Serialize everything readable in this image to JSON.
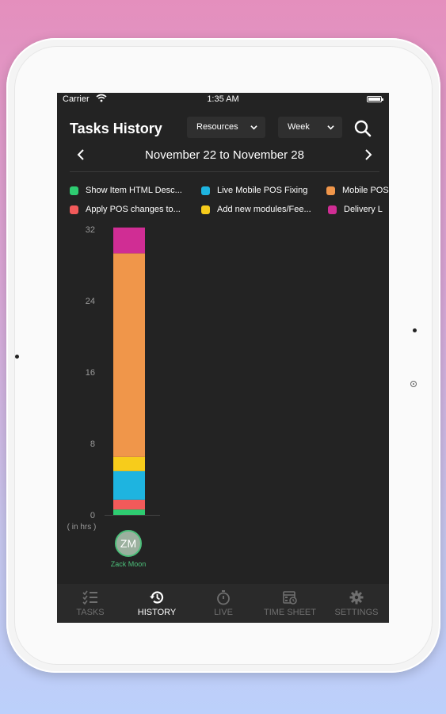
{
  "status_bar": {
    "carrier": "Carrier",
    "time": "1:35 AM"
  },
  "header": {
    "title": "Tasks History",
    "resources_dropdown": "Resources",
    "period_dropdown": "Week"
  },
  "date_nav": {
    "range": "November 22 to November 28"
  },
  "legend": [
    {
      "label": "Show Item HTML Desc...",
      "color": "#2ecc71"
    },
    {
      "label": "Live Mobile POS Fixing",
      "color": "#1eb4e0"
    },
    {
      "label": "Mobile POS",
      "color": "#f0964a"
    },
    {
      "label": "Apply POS changes to...",
      "color": "#f25a5a"
    },
    {
      "label": "Add new modules/Fee...",
      "color": "#f7cc1b"
    },
    {
      "label": "Delivery  L",
      "color": "#d02d94"
    }
  ],
  "chart_data": {
    "type": "bar",
    "stacked": true,
    "categories": [
      "Zack Moon"
    ],
    "ylabel": "( in hrs )",
    "yticks": [
      0,
      8,
      16,
      24,
      32
    ],
    "ylim": [
      0,
      32
    ],
    "series": [
      {
        "name": "Show Item HTML Desc...",
        "values": [
          0.6
        ],
        "color": "#2ecc71"
      },
      {
        "name": "Apply POS changes to...",
        "values": [
          1.1
        ],
        "color": "#f25a5a"
      },
      {
        "name": "Live Mobile POS Fixing",
        "values": [
          3.2
        ],
        "color": "#1eb4e0"
      },
      {
        "name": "Add new modules/Fee...",
        "values": [
          1.6
        ],
        "color": "#f7cc1b"
      },
      {
        "name": "Mobile POS",
        "values": [
          22.8
        ],
        "color": "#f0964a"
      },
      {
        "name": "Delivery  L",
        "values": [
          2.9
        ],
        "color": "#d02d94"
      }
    ]
  },
  "resource": {
    "initials": "ZM",
    "name": "Zack Moon"
  },
  "tabs": [
    {
      "label": "TASKS",
      "icon": "tasks-list-icon",
      "active": false
    },
    {
      "label": "HISTORY",
      "icon": "history-icon",
      "active": true
    },
    {
      "label": "LIVE",
      "icon": "stopwatch-icon",
      "active": false
    },
    {
      "label": "TIME SHEET",
      "icon": "timesheet-icon",
      "active": false
    },
    {
      "label": "SETTINGS",
      "icon": "gear-icon",
      "active": false
    }
  ],
  "colors": {
    "screen_bg": "#232323",
    "accent_green": "#4cbf7a"
  }
}
